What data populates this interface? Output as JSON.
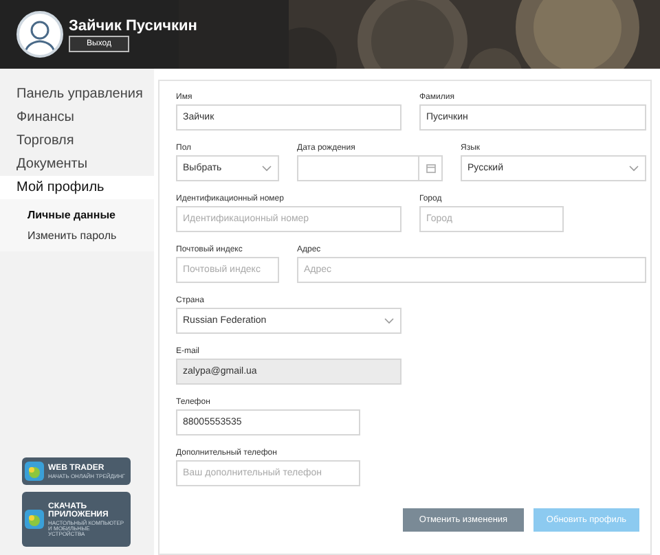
{
  "header": {
    "user_name": "Зайчик Пусичкин",
    "logout_button": "Выход"
  },
  "sidebar": {
    "items": [
      {
        "label": "Панель управления",
        "selected": false
      },
      {
        "label": "Финансы",
        "selected": false
      },
      {
        "label": "Торговля",
        "selected": false
      },
      {
        "label": "Документы",
        "selected": false
      },
      {
        "label": "Мой профиль",
        "selected": true,
        "children": [
          {
            "label": "Личные данные",
            "selected": true
          },
          {
            "label": "Изменить пароль",
            "selected": false
          }
        ]
      }
    ],
    "promos": [
      {
        "title": "WEB TRADER",
        "subtitle": "НАЧАТЬ ОНЛАЙН ТРЕЙДИНГ"
      },
      {
        "title": "СКАЧАТЬ ПРИЛОЖЕНИЯ",
        "subtitle": "НАСТОЛЬНЫЙ КОМПЬЮТЕР И МОБИЛЬНЫЕ УСТРОЙСТВА"
      }
    ]
  },
  "form": {
    "rows": [
      [
        {
          "label": "Имя",
          "kind": "text",
          "value": "Зайчик",
          "disabled": false
        },
        {
          "label": "Фамилия",
          "kind": "text",
          "value": "Пусичкин",
          "disabled": false
        }
      ],
      [
        {
          "label": "Пол",
          "kind": "select",
          "value": "Выбрать",
          "disabled": false
        },
        {
          "label": "Дата рождения",
          "kind": "date",
          "disabled": false
        },
        {
          "label": "Язык",
          "kind": "select",
          "value": "Русский",
          "disabled": false
        }
      ],
      [
        {
          "label": "Идентификационный номер",
          "kind": "text",
          "placeholder": "Идентификационный номер",
          "disabled": false
        },
        {
          "label": "Город",
          "kind": "text",
          "placeholder": "Город",
          "disabled": false
        }
      ],
      [
        {
          "label": "Почтовый индекс",
          "kind": "text",
          "placeholder": "Почтовый индекс",
          "disabled": false
        },
        {
          "label": "Адрес",
          "kind": "text",
          "placeholder": "Адрес",
          "disabled": false
        }
      ],
      [
        {
          "label": "Страна",
          "kind": "select",
          "value": "Russian Federation",
          "disabled": false
        }
      ],
      [
        {
          "label": "E-mail",
          "kind": "text",
          "value": "zalypa@gmail.ua",
          "disabled": true
        }
      ],
      [
        {
          "label": "Телефон",
          "kind": "text",
          "value": "88005553535",
          "disabled": false
        }
      ],
      [
        {
          "label": "Дополнительный телефон",
          "kind": "text",
          "placeholder": "Ваш дополнительный телефон",
          "disabled": false
        }
      ]
    ],
    "buttons": [
      {
        "label": "Отменить изменения",
        "kind": "cancel"
      },
      {
        "label": "Обновить профиль",
        "kind": "submit"
      }
    ]
  }
}
